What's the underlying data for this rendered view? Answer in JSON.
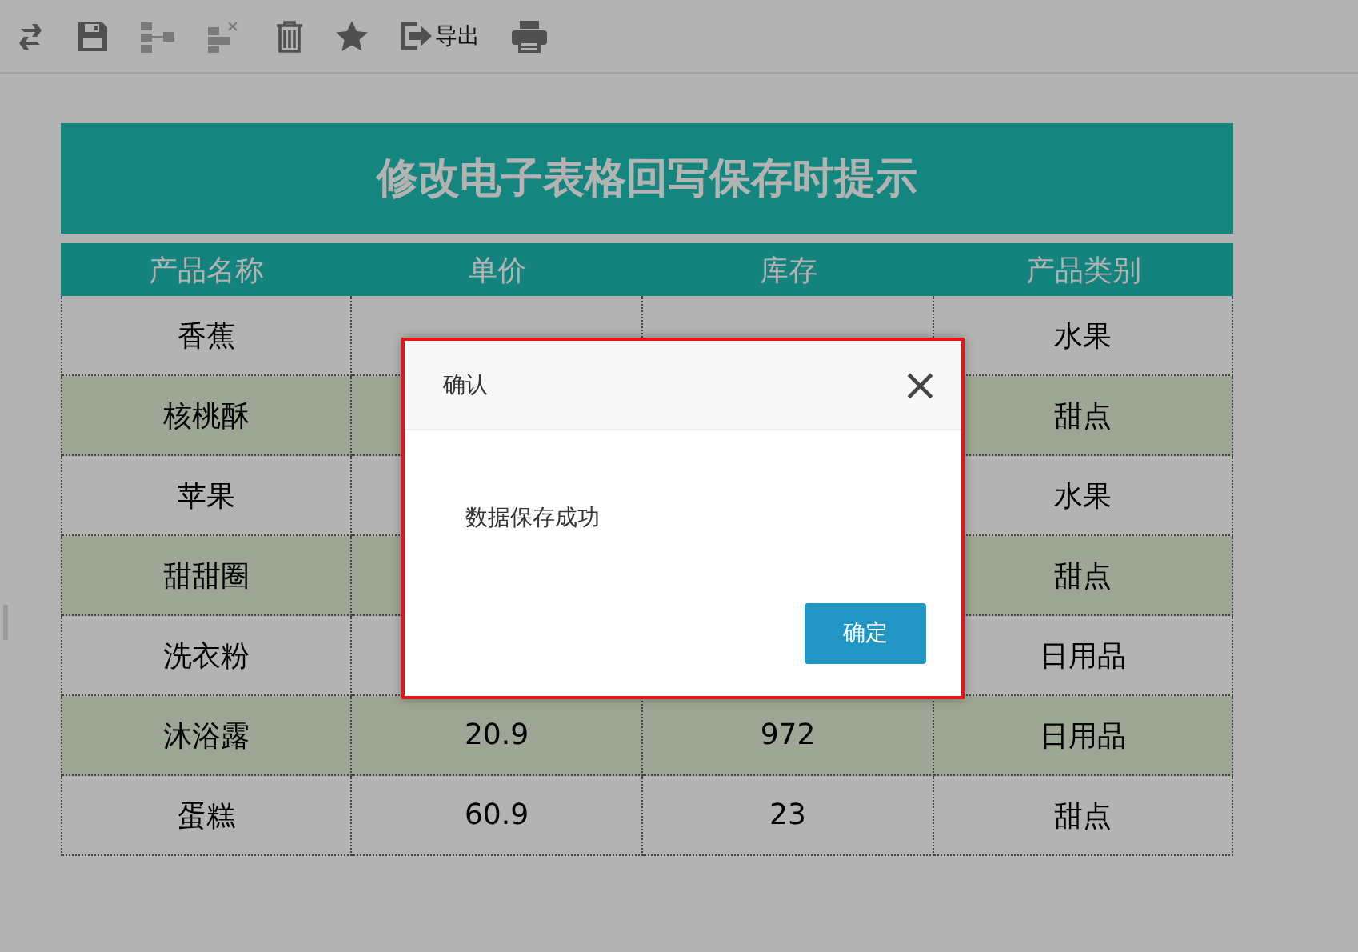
{
  "toolbar": [
    {
      "kind": "refresh",
      "disabled": false
    },
    {
      "kind": "save",
      "disabled": false
    },
    {
      "kind": "insert-row",
      "disabled": true
    },
    {
      "kind": "delete-row",
      "disabled": true
    },
    {
      "kind": "trash",
      "disabled": false
    },
    {
      "kind": "star",
      "disabled": false
    },
    {
      "kind": "export",
      "label": "导出",
      "disabled": false
    },
    {
      "kind": "print",
      "disabled": false
    }
  ],
  "report": {
    "title": "修改电子表格回写保存时提示",
    "columns": [
      "产品名称",
      "单价",
      "库存",
      "产品类别"
    ],
    "rows": [
      {
        "cells": [
          "香蕉",
          null,
          null,
          "水果"
        ]
      },
      {
        "cells": [
          "核桃酥",
          null,
          null,
          "甜点"
        ]
      },
      {
        "cells": [
          "苹果",
          null,
          null,
          "水果"
        ]
      },
      {
        "cells": [
          "甜甜圈",
          null,
          null,
          "甜点"
        ]
      },
      {
        "cells": [
          "洗衣粉",
          null,
          null,
          "日用品"
        ]
      },
      {
        "cells": [
          "沐浴露",
          "20.9",
          "972",
          "日用品"
        ]
      },
      {
        "cells": [
          "蛋糕",
          "60.9",
          "23",
          "甜点"
        ]
      }
    ]
  },
  "dialog": {
    "title": "确认",
    "close": "×",
    "message": "数据保存成功",
    "button": "确定"
  }
}
